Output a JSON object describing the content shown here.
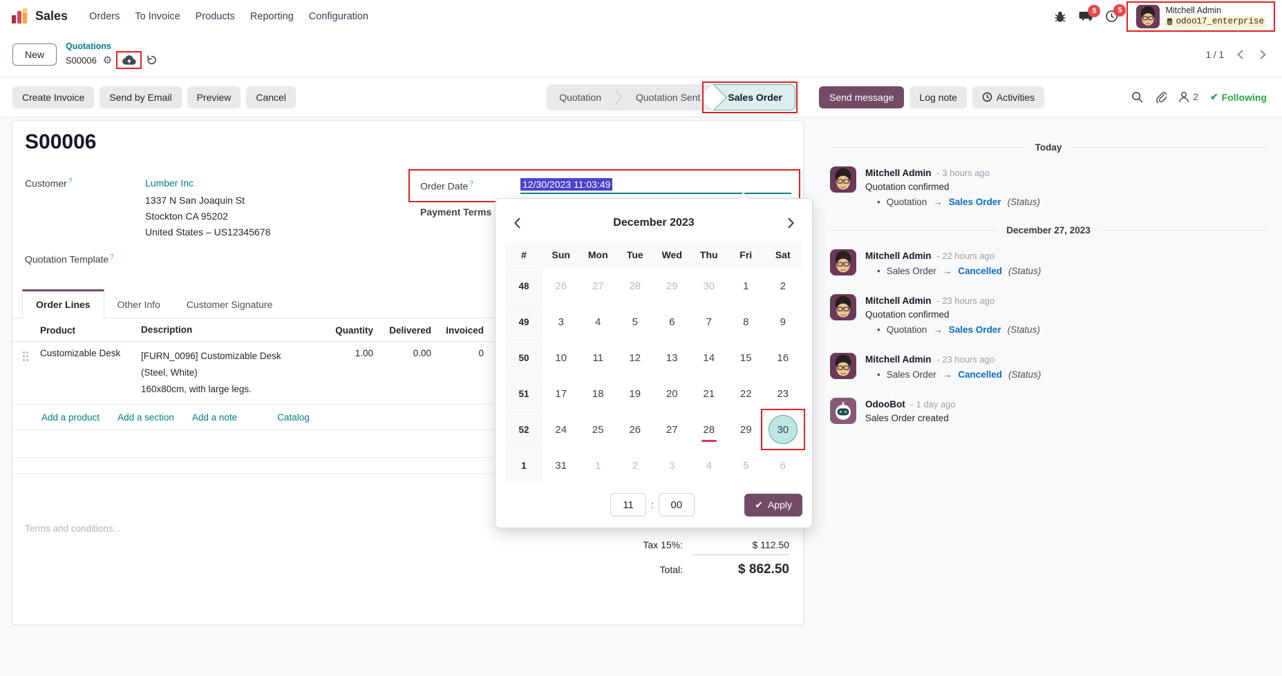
{
  "nav": {
    "app_name": "Sales",
    "items": [
      "Orders",
      "To Invoice",
      "Products",
      "Reporting",
      "Configuration"
    ],
    "message_badge": "5",
    "activity_badge": "5",
    "user_name": "Mitchell Admin",
    "database": "odoo17_enterprise"
  },
  "breadcrumb": {
    "new_label": "New",
    "parent": "Quotations",
    "current": "S00006",
    "pager": "1 / 1"
  },
  "toolbar": {
    "buttons": [
      "Create Invoice",
      "Send by Email",
      "Preview",
      "Cancel"
    ],
    "steps": [
      "Quotation",
      "Quotation Sent",
      "Sales Order"
    ]
  },
  "chatter": {
    "send_message_label": "Send message",
    "log_note_label": "Log note",
    "activities_label": "Activities",
    "followers_count": "2",
    "following_label": "Following",
    "feed": [
      {
        "type": "divider",
        "label": "Today"
      },
      {
        "type": "message",
        "author": "Mitchell Admin",
        "time": "- 3 hours ago",
        "body": "Quotation confirmed",
        "tracking": {
          "old": "Quotation",
          "new": "Sales Order",
          "field": "(Status)"
        }
      },
      {
        "type": "divider",
        "label": "December 27, 2023"
      },
      {
        "type": "message",
        "author": "Mitchell Admin",
        "time": "- 22 hours ago",
        "tracking": {
          "old": "Sales Order",
          "new": "Cancelled",
          "field": "(Status)"
        }
      },
      {
        "type": "message",
        "author": "Mitchell Admin",
        "time": "- 23 hours ago",
        "body": "Quotation confirmed",
        "tracking": {
          "old": "Quotation",
          "new": "Sales Order",
          "field": "(Status)"
        }
      },
      {
        "type": "message",
        "author": "Mitchell Admin",
        "time": "- 23 hours ago",
        "tracking": {
          "old": "Sales Order",
          "new": "Cancelled",
          "field": "(Status)"
        }
      },
      {
        "type": "message",
        "author": "OdooBot",
        "time": "- 1 day ago",
        "body": "Sales Order created",
        "bot": true
      }
    ]
  },
  "form": {
    "title": "S00006",
    "customer_label": "Customer",
    "customer_name": "Lumber Inc",
    "address_lines": [
      "1337 N San Joaquin St",
      "Stockton CA 95202",
      "United States – US12345678"
    ],
    "order_date_label": "Order Date",
    "order_date_value": "12/30/2023 11:03:49",
    "payment_terms_label": "Payment Terms",
    "quotation_template_label": "Quotation Template",
    "tabs": [
      "Order Lines",
      "Other Info",
      "Customer Signature"
    ],
    "table": {
      "headers": [
        "Product",
        "Description",
        "Quantity",
        "Delivered",
        "Invoiced"
      ],
      "rows": [
        {
          "product": "Customizable Desk",
          "description_lines": [
            "[FURN_0096] Customizable Desk",
            "(Steel, White)",
            "160x80cm, with large legs."
          ],
          "quantity": "1.00",
          "delivered": "0.00",
          "invoiced": "0"
        }
      ]
    },
    "links": [
      "Add a product",
      "Add a section",
      "Add a note",
      "Catalog"
    ],
    "terms_placeholder": "Terms and conditions...",
    "totals": {
      "tax_label": "Tax 15%:",
      "tax_value": "$ 112.50",
      "total_label": "Total:",
      "total_value": "$ 862.50"
    }
  },
  "calendar": {
    "month_label": "December 2023",
    "day_headers": [
      "#",
      "Sun",
      "Mon",
      "Tue",
      "Wed",
      "Thu",
      "Fri",
      "Sat"
    ],
    "weeks": [
      {
        "num": "48",
        "days": [
          {
            "d": "26",
            "muted": true
          },
          {
            "d": "27",
            "muted": true
          },
          {
            "d": "28",
            "muted": true
          },
          {
            "d": "29",
            "muted": true
          },
          {
            "d": "30",
            "muted": true
          },
          {
            "d": "1"
          },
          {
            "d": "2"
          }
        ]
      },
      {
        "num": "49",
        "days": [
          {
            "d": "3"
          },
          {
            "d": "4"
          },
          {
            "d": "5"
          },
          {
            "d": "6"
          },
          {
            "d": "7"
          },
          {
            "d": "8"
          },
          {
            "d": "9"
          }
        ]
      },
      {
        "num": "50",
        "days": [
          {
            "d": "10"
          },
          {
            "d": "11"
          },
          {
            "d": "12"
          },
          {
            "d": "13"
          },
          {
            "d": "14"
          },
          {
            "d": "15"
          },
          {
            "d": "16"
          }
        ]
      },
      {
        "num": "51",
        "days": [
          {
            "d": "17"
          },
          {
            "d": "18"
          },
          {
            "d": "19"
          },
          {
            "d": "20"
          },
          {
            "d": "21"
          },
          {
            "d": "22"
          },
          {
            "d": "23"
          }
        ]
      },
      {
        "num": "52",
        "days": [
          {
            "d": "24"
          },
          {
            "d": "25"
          },
          {
            "d": "26"
          },
          {
            "d": "27"
          },
          {
            "d": "28",
            "today": true
          },
          {
            "d": "29"
          },
          {
            "d": "30",
            "selected": true,
            "annotated": true
          }
        ]
      },
      {
        "num": "1",
        "days": [
          {
            "d": "31"
          },
          {
            "d": "1",
            "muted": true
          },
          {
            "d": "2",
            "muted": true
          },
          {
            "d": "3",
            "muted": true
          },
          {
            "d": "4",
            "muted": true
          },
          {
            "d": "5",
            "muted": true
          },
          {
            "d": "6",
            "muted": true
          }
        ]
      }
    ],
    "hour": "11",
    "minute": "00",
    "apply_label": "Apply"
  },
  "colors": {
    "accent_purple": "#714B67",
    "link_teal": "#017E84",
    "selected_day_fill": "#BFE5E3",
    "annotation_red": "#E0201F",
    "following_green": "#28A745",
    "tracking_blue": "#0A6EBD",
    "selection_highlight": "#4A43CF"
  }
}
